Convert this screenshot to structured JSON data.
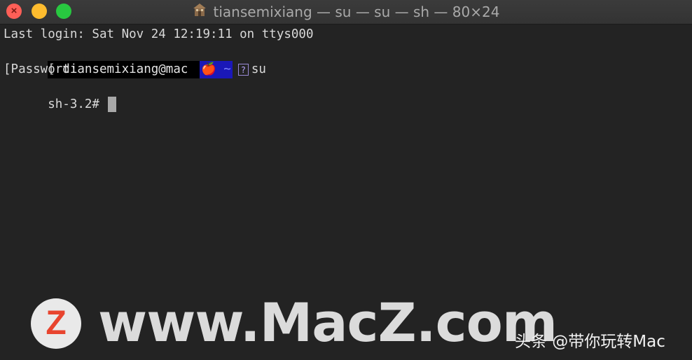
{
  "window": {
    "title": "tiansemixiang — su — su — sh — 80×24",
    "close_glyph": "×"
  },
  "terminal": {
    "line1": "Last login: Sat Nov 24 12:19:11 on ttys000",
    "line2_bracket": "[",
    "line2_user": " tiansemixiang@mac ",
    "line2_highlight": "🍎 ~",
    "line2_qmark": "?",
    "line2_command": "su",
    "line3": "[Password:",
    "line4_prompt": "sh-3.2#"
  },
  "watermark": {
    "logo_letter": "Z",
    "site": "www.MacZ.com",
    "side_text": "头条 @带你玩转Mac"
  },
  "colors": {
    "close": "#fe5f57",
    "minimize": "#febc2e",
    "maximize": "#28c840",
    "terminal_bg": "#232323",
    "highlight_bg": "#1a18b8"
  }
}
